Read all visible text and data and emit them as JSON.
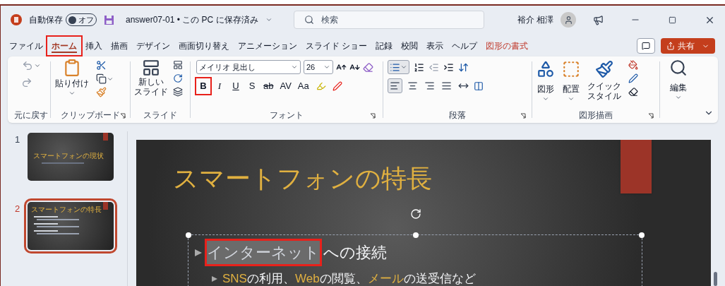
{
  "titlebar": {
    "autosave_label": "自動保存",
    "autosave_toggle": {
      "label": "オフ",
      "on": false
    },
    "document_title": "answer07-01 • この PC に保存済み",
    "search": {
      "placeholder": "検索"
    },
    "user_name": "裕介 相澤"
  },
  "tabs": [
    {
      "label": "ファイル",
      "selected": false,
      "highlighted": false,
      "kind": "normal"
    },
    {
      "label": "ホーム",
      "selected": true,
      "highlighted": true,
      "kind": "normal"
    },
    {
      "label": "挿入",
      "selected": false,
      "highlighted": false,
      "kind": "normal"
    },
    {
      "label": "描画",
      "selected": false,
      "highlighted": false,
      "kind": "normal"
    },
    {
      "label": "デザイン",
      "selected": false,
      "highlighted": false,
      "kind": "normal"
    },
    {
      "label": "画面切り替え",
      "selected": false,
      "highlighted": false,
      "kind": "normal"
    },
    {
      "label": "アニメーション",
      "selected": false,
      "highlighted": false,
      "kind": "normal"
    },
    {
      "label": "スライド ショー",
      "selected": false,
      "highlighted": false,
      "kind": "normal"
    },
    {
      "label": "記録",
      "selected": false,
      "highlighted": false,
      "kind": "normal"
    },
    {
      "label": "校閲",
      "selected": false,
      "highlighted": false,
      "kind": "normal"
    },
    {
      "label": "表示",
      "selected": false,
      "highlighted": false,
      "kind": "normal"
    },
    {
      "label": "ヘルプ",
      "selected": false,
      "highlighted": false,
      "kind": "normal"
    },
    {
      "label": "図形の書式",
      "selected": false,
      "highlighted": false,
      "kind": "contextual"
    }
  ],
  "share_button": {
    "label": "共有"
  },
  "ribbon": {
    "undo": {
      "label": "元に戻す"
    },
    "clipboard": {
      "label": "クリップボード",
      "paste": "貼り付け"
    },
    "slides": {
      "label": "スライド",
      "new_slide": [
        "新しい",
        "スライド"
      ]
    },
    "font": {
      "label": "フォント",
      "font_name": "メイリオ 見出し",
      "font_size": "26",
      "buttons": [
        {
          "label": "B",
          "kind": "bold",
          "highlighted": true
        },
        {
          "label": "I",
          "kind": "italic",
          "highlighted": false
        },
        {
          "label": "U",
          "kind": "underline",
          "highlighted": false
        },
        {
          "label": "S",
          "kind": "shadow",
          "highlighted": false
        },
        {
          "label": "ab",
          "kind": "strike",
          "highlighted": false
        },
        {
          "label": "AV",
          "kind": "spacing",
          "highlighted": false
        },
        {
          "label": "Aa",
          "kind": "case",
          "highlighted": false
        }
      ]
    },
    "paragraph": {
      "label": "段落",
      "bullets": {
        "selected": true
      },
      "alignments": [
        {
          "kind": "left",
          "selected": true
        },
        {
          "kind": "center",
          "selected": false
        },
        {
          "kind": "right",
          "selected": false
        },
        {
          "kind": "justify",
          "selected": false
        },
        {
          "kind": "distributed",
          "selected": false
        }
      ]
    },
    "drawing": {
      "label": "図形描画",
      "shapes": "図形",
      "arrange": "配置",
      "quick_styles": [
        "クイック",
        "スタイル"
      ]
    },
    "editing": {
      "label": "編集"
    }
  },
  "thumbnails": [
    {
      "number": "1",
      "title": "スマートフォンの現状",
      "selected": false
    },
    {
      "number": "2",
      "title": "スマートフォンの特長",
      "selected": true
    }
  ],
  "slide": {
    "title": "スマートフォンの特長",
    "bullets": [
      {
        "runs": [
          {
            "text": "インターネット",
            "highlighted": true,
            "accent": false
          },
          {
            "text": "への接続",
            "highlighted": false,
            "accent": false
          }
        ],
        "children": [
          {
            "runs": [
              {
                "text": "SNS",
                "highlighted": false,
                "accent": true
              },
              {
                "text": "の利用、",
                "highlighted": false,
                "accent": false
              },
              {
                "text": "Web",
                "highlighted": false,
                "accent": true
              },
              {
                "text": "の閲覧、",
                "highlighted": false,
                "accent": false
              },
              {
                "text": "メール",
                "highlighted": false,
                "accent": true
              },
              {
                "text": "の送受信など",
                "highlighted": false,
                "accent": false
              }
            ]
          }
        ]
      }
    ]
  }
}
